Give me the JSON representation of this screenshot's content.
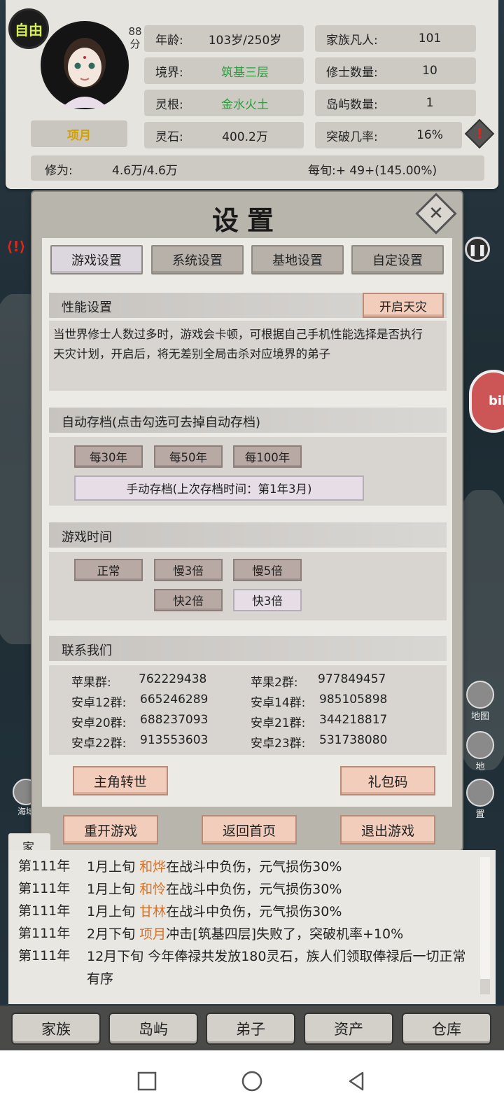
{
  "status": {
    "free_badge": "自由",
    "score_value": "88",
    "score_unit": "分",
    "name": "项月",
    "stats_left": [
      {
        "label": "年龄:",
        "value": "103岁/250岁"
      },
      {
        "label": "境界:",
        "value": "筑基三层"
      },
      {
        "label": "灵根:",
        "value": "金水火土"
      },
      {
        "label": "灵石:",
        "value": "400.2万"
      }
    ],
    "stats_right": [
      {
        "label": "家族凡人:",
        "value": "101"
      },
      {
        "label": "修士数量:",
        "value": "10"
      },
      {
        "label": "岛屿数量:",
        "value": "1"
      },
      {
        "label": "突破几率:",
        "value": "16%"
      }
    ],
    "cultivation_label": "修为:",
    "cultivation_value": "4.6万/4.6万",
    "per_period": "每旬:+ 49+(145.00%)"
  },
  "settings": {
    "title": "设置",
    "close_symbol": "✕",
    "tabs": [
      "游戏设置",
      "系统设置",
      "基地设置",
      "自定设置"
    ],
    "performance": {
      "header": "性能设置",
      "toggle_button": "开启天灾",
      "description": "当世界修士人数过多时，游戏会卡顿，可根据自己手机性能选择是否执行天灾计划，开启后，将无差别全局击杀对应境界的弟子"
    },
    "autosave": {
      "header": "自动存档(点击勾选可去掉自动存档)",
      "options": [
        "每30年",
        "每50年",
        "每100年"
      ],
      "manual_button": "手动存档(上次存档时间：第1年3月)"
    },
    "game_time": {
      "header": "游戏时间",
      "speeds": [
        "正常",
        "慢3倍",
        "慢5倍",
        "快2倍",
        "快3倍"
      ]
    },
    "contact": {
      "header": "联系我们",
      "groups": [
        {
          "label": "苹果群:",
          "number": "762229438"
        },
        {
          "label": "苹果2群:",
          "number": "977849457"
        },
        {
          "label": "安卓12群:",
          "number": "665246289"
        },
        {
          "label": "安卓14群:",
          "number": "985105898"
        },
        {
          "label": "安卓20群:",
          "number": "688237093"
        },
        {
          "label": "安卓21群:",
          "number": "344218817"
        },
        {
          "label": "安卓22群:",
          "number": "913553603"
        },
        {
          "label": "安卓23群:",
          "number": "531738080"
        }
      ],
      "reincarnate_button": "主角转世",
      "giftcode_button": "礼包码"
    },
    "footer_buttons": [
      "重开游戏",
      "返回首页",
      "退出游戏"
    ]
  },
  "side": {
    "right_tools": [
      "地图",
      "地",
      "置"
    ],
    "left_tool": "海域"
  },
  "log": {
    "tab": "家",
    "entries": [
      {
        "year": "第111年",
        "when": "1月上旬 ",
        "name": "和烨",
        "text": "在战斗中负伤，元气损伤30%"
      },
      {
        "year": "第111年",
        "when": "1月上旬 ",
        "name": "和怜",
        "text": "在战斗中负伤，元气损伤30%"
      },
      {
        "year": "第111年",
        "when": "1月上旬 ",
        "name": "甘林",
        "text": "在战斗中负伤，元气损伤30%"
      },
      {
        "year": "第111年",
        "when": "2月下旬 ",
        "name": "项月",
        "text": "冲击[筑基四层]失败了，突破机率+10%"
      },
      {
        "year": "第111年",
        "when": "12月下旬 ",
        "name": "",
        "text": "今年俸禄共发放180灵石，族人们领取俸禄后一切正常有序"
      }
    ]
  },
  "bottom_nav": [
    "家族",
    "岛屿",
    "弟子",
    "资产",
    "仓库"
  ],
  "colors": {
    "realm_green": "#29a03b",
    "name_orange": "#d7722a",
    "name_gold": "#d4a000",
    "warning_red": "#e0251a"
  }
}
